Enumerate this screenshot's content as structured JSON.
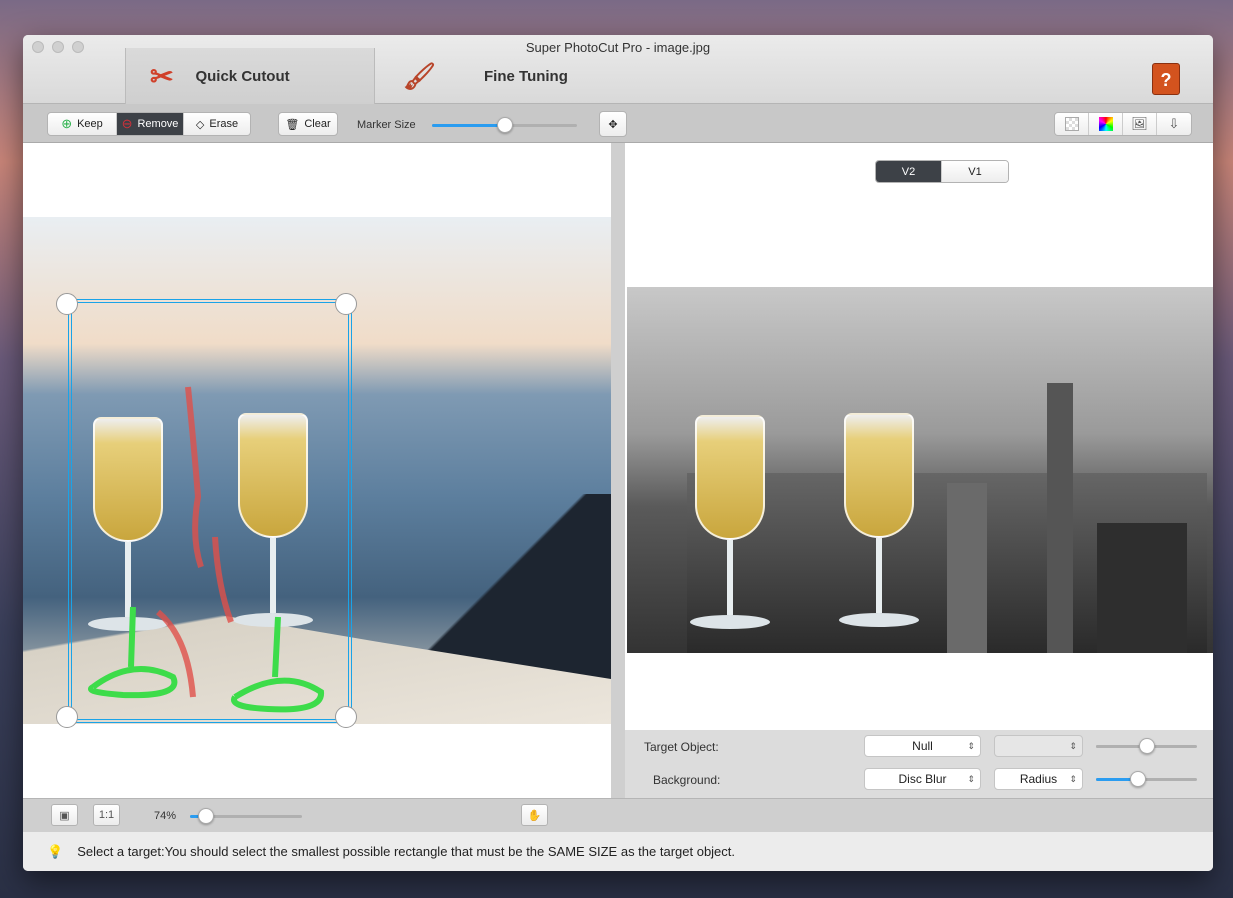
{
  "window": {
    "title": "Super PhotoCut Pro - image.jpg"
  },
  "tabs": [
    {
      "label": "Quick Cutout",
      "icon": "scissors-icon",
      "active": true
    },
    {
      "label": "Fine Tuning",
      "icon": "paintbrush-icon",
      "active": false
    }
  ],
  "help": {
    "icon": "help-book-icon",
    "label": "?"
  },
  "toolbar": {
    "keep": "Keep",
    "remove": "Remove",
    "erase": "Erase",
    "clear": "Clear",
    "marker_size_label": "Marker Size",
    "marker_size_value": 0.5,
    "right_icons": [
      "transparent-bg-icon",
      "color-picker-icon",
      "image-bg-icon",
      "export-icon"
    ]
  },
  "version": {
    "options": [
      "V2",
      "V1"
    ],
    "selected": "V2"
  },
  "controls": {
    "target_label": "Target Object:",
    "target_value": "Null",
    "target_secondary": "",
    "target_slider": 0.5,
    "background_label": "Background:",
    "background_value": "Disc Blur",
    "background_param": "Radius",
    "background_slider": 0.42
  },
  "bottom": {
    "fit_icon": "fit-screen-icon",
    "actual_size": "1:1",
    "zoom": "74%",
    "zoom_slider": 0.14,
    "hand_icon": "hand-icon"
  },
  "status": {
    "icon": "lightbulb-icon",
    "text": "Select a target:You should select the smallest possible rectangle that must be the SAME SIZE as the target object."
  },
  "colors": {
    "accent": "#2a9cf0",
    "selection": "#1aa3e8",
    "remove_active": "#3d4147",
    "keep_mark": "#3ddc4a",
    "remove_mark": "#e0504a"
  }
}
